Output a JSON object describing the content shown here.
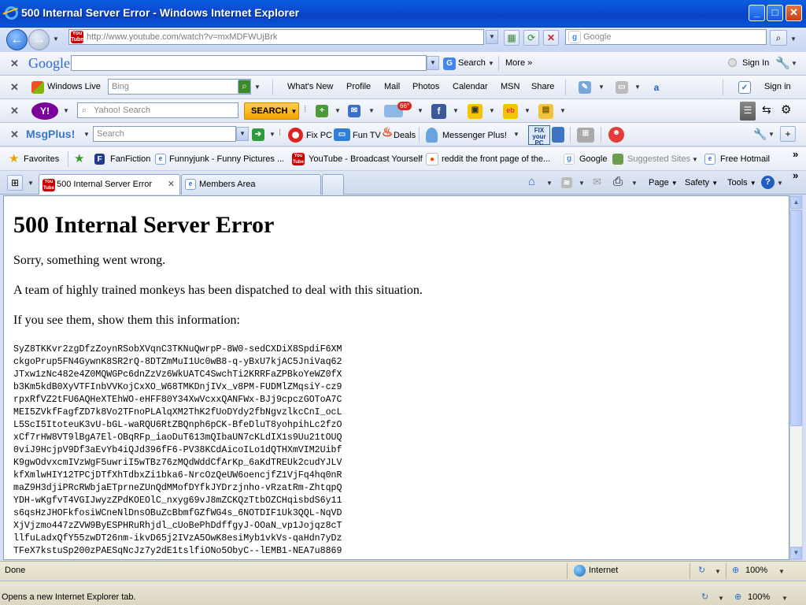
{
  "window": {
    "title": "500 Internal Server Error - Windows Internet Explorer",
    "minimize": "_",
    "maximize": "□",
    "close": "✕"
  },
  "address_bar": {
    "url": "http://www.youtube.com/watch?v=mxMDFWUjBrk",
    "search_placeholder": "Google"
  },
  "google_toolbar": {
    "close": "✕",
    "logo": "Google",
    "search_label": "Search",
    "more_label": "More »",
    "sign_in": "Sign In"
  },
  "live_toolbar": {
    "close": "✕",
    "logo": "Windows Live",
    "search_placeholder": "Bing",
    "links": [
      "What's New",
      "Profile",
      "Mail",
      "Photos",
      "Calendar",
      "MSN",
      "Share"
    ],
    "sign_in": "Sign in"
  },
  "yahoo_toolbar": {
    "close": "✕",
    "logo": "Y!",
    "search_placeholder": "Yahoo! Search",
    "search_button": "SEARCH",
    "weather_badge": "66°"
  },
  "msgplus_toolbar": {
    "close": "✕",
    "logo": "MsgPlus!",
    "search_placeholder": "Search",
    "items": [
      "Fix PC",
      "Fun TV",
      "Deals",
      "Messenger Plus!"
    ],
    "fix_badge": "FIX your PC"
  },
  "favorites_bar": {
    "favorites_label": "Favorites",
    "items": [
      "FanFiction",
      "Funnyjunk - Funny Pictures ...",
      "YouTube - Broadcast Yourself",
      "reddit the front page of the...",
      "Google",
      "Suggested Sites",
      "Free Hotmail"
    ]
  },
  "tabs": {
    "items": [
      "500 Internal Server Error",
      "Members Area"
    ],
    "close": "✕",
    "commands": [
      "Page",
      "Safety",
      "Tools"
    ]
  },
  "page": {
    "heading": "500 Internal Server Error",
    "line1": "Sorry, something went wrong.",
    "line2": "A team of highly trained monkeys has been dispatched to deal with this situation.",
    "line3": "If you see them, show them this information:",
    "code_lines": [
      "SyZ8TKKvr2zgDfzZoynRSobXVqnC3TKNuQwrpP-8W0-sedCXDiX8SpdiF6XM",
      "ckgoPrup5FN4GywnK8SR2rQ-8DTZmMuI1Uc0wB8-q-yBxU7kjAC5JniVaq62",
      "JTxw1zNc482e4Z0MQWGPc6dnZzVz6WkUATC4SwchTi2KRRFaZPBkoYeWZ0fX",
      "b3Km5kdB0XyVTFInbVVKojCxXO_W68TMKDnjIVx_v8PM-FUDMlZMqsiY-cz9",
      "rpxRfVZ2tFU6AQHeXTEhWO-eHFF80Y34XwVcxxQANFWx-BJj9cpczGOToA7C",
      "MEI5ZVkfFagfZD7k8Vo2TFnoPLAlqXM2ThK2fUoDYdy2fbNgvzlkcCnI_ocL",
      "L5ScI5ItoteuK3vU-bGL-waRQU6RtZBQnph6pCK-BfeDluT8yohpihLc2fzO",
      "xCf7rHW8VT9lBgA7El-OBqRFp_iaoDuT613mQIbaUN7cKLdIX1s9Uu21tOUQ",
      "0viJ9HcjpV9Df3aEvYb4iQJd396fF6-PV38KCdAicoILo1dQTHXmVIM2Uibf",
      "K9gwOdvxcmIVzWgF5uwriI5wTBz76zMQdWddCfArKp_6aKdTREUk2cudYJLV",
      "kfXmlwHIY12TPCjDTfXhTdbxZi1bka6-NrcOzQeUW6oencjfZ1VjFq4hq0nR",
      "maZ9H3djiPRcRWbjaETprneZUnQdMMofDYfkJYDrzjnho-vRzatRm-ZhtqpQ",
      "YDH-wKgfvT4VGIJwyzZPdKOEOlC_nxyg69vJ8mZCKQzTtbOZCHqisbdS6y11",
      "s6qsHzJHOFkfosiWCneNlDnsOBuZcBbmfGZfWG4s_6NOTDIF1Uk3QQL-NqVD",
      "XjVjzmo447zZVW9ByESPHRuRhjdl_cUoBePhDdffgyJ-OOaN_vp1Jojqz8cT",
      "llfuLadxQfY55zwDT26nm-ikvD65j2IVzA5OwK8esiMyb1vkVs-qaHdn7yDz",
      "TFeX7kstuSp200zPAESqNcJz7y2dE1tslfiONo5ObyC--lEMB1-NEA7u8869"
    ]
  },
  "status": {
    "left": "Done",
    "zone": "Internet",
    "zoom": "100%"
  },
  "status2": {
    "left": "Opens a new Internet Explorer tab.",
    "zoom": "100%"
  }
}
